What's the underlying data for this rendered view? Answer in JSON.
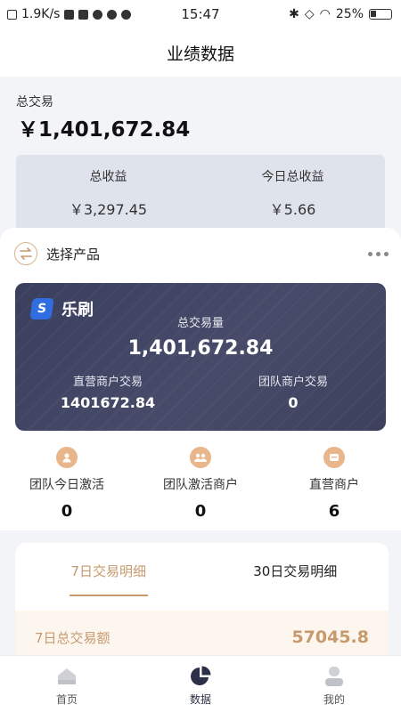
{
  "status_bar": {
    "speed": "1.9K/s",
    "time": "15:47",
    "battery": "25%"
  },
  "nav": {
    "title": "业绩数据"
  },
  "summary": {
    "total_label": "总交易",
    "total_value": "￥1,401,672.84",
    "earnings": [
      {
        "label": "总收益",
        "value": "￥3,297.45"
      },
      {
        "label": "今日总收益",
        "value": "￥5.66"
      }
    ]
  },
  "product": {
    "label": "选择产品"
  },
  "card": {
    "brand": "乐刷",
    "volume_label": "总交易量",
    "volume_value": "1,401,672.84",
    "direct_label": "直营商户交易",
    "direct_value": "1401672.84",
    "team_label": "团队商户交易",
    "team_value": "0"
  },
  "stats": [
    {
      "label": "团队今日激活",
      "value": "0",
      "icon": "user-icon"
    },
    {
      "label": "团队激活商户",
      "value": "0",
      "icon": "team-icon"
    },
    {
      "label": "直营商户",
      "value": "6",
      "icon": "store-icon"
    }
  ],
  "detail": {
    "tabs": [
      "7日交易明细",
      "30日交易明细"
    ],
    "active_tab": 0,
    "total_label": "7日总交易额",
    "total_value": "57045.8"
  },
  "tab_bar": {
    "items": [
      {
        "label": "首页",
        "icon": "home-icon"
      },
      {
        "label": "数据",
        "icon": "pie-chart-icon"
      },
      {
        "label": "我的",
        "icon": "profile-icon"
      }
    ],
    "active": 1
  },
  "colors": {
    "accent": "#c69a6d",
    "card": "#3f4362",
    "earn_bg": "#dfe3ec"
  }
}
